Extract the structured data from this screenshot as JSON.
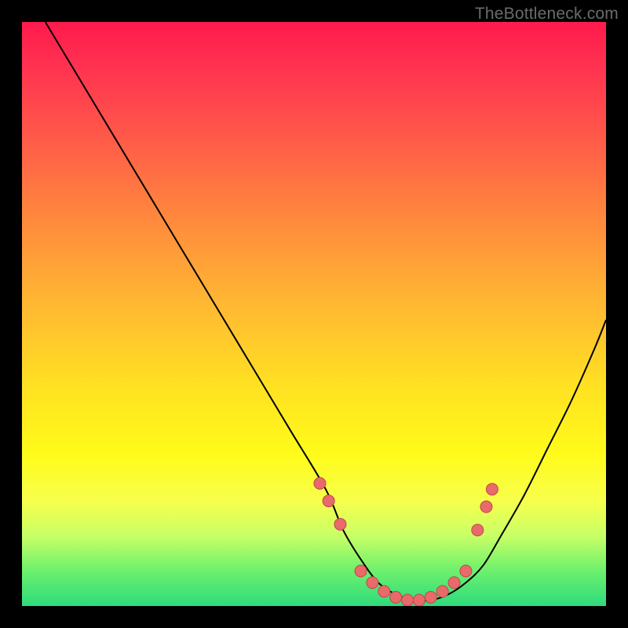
{
  "watermark": "TheBottleneck.com",
  "colors": {
    "background": "#000000",
    "curve": "#000000",
    "dot_fill": "#e96a6a",
    "dot_stroke": "#c24747"
  },
  "chart_data": {
    "type": "line",
    "title": "",
    "xlabel": "",
    "ylabel": "",
    "xlim": [
      0,
      100
    ],
    "ylim": [
      0,
      100
    ],
    "grid": false,
    "legend": false,
    "series": [
      {
        "name": "bottleneck-curve",
        "x": [
          4,
          10,
          16,
          22,
          28,
          34,
          40,
          46,
          52,
          55,
          58,
          61,
          64,
          67,
          70,
          73,
          76,
          79,
          82,
          86,
          90,
          94,
          98,
          100
        ],
        "y": [
          100,
          90,
          80,
          70,
          60,
          50,
          40,
          30,
          20,
          13,
          8,
          4,
          2,
          1,
          1,
          2,
          4,
          7,
          12,
          19,
          27,
          35,
          44,
          49
        ]
      }
    ],
    "highlight_points": {
      "name": "sample-dots",
      "x": [
        51,
        52.5,
        54.5,
        58,
        60,
        62,
        64,
        66,
        68,
        70,
        72,
        74,
        76,
        78,
        79.5,
        80.5
      ],
      "y": [
        21,
        18,
        14,
        6,
        4,
        2.5,
        1.5,
        1,
        1,
        1.5,
        2.5,
        4,
        6,
        13,
        17,
        20
      ]
    }
  }
}
